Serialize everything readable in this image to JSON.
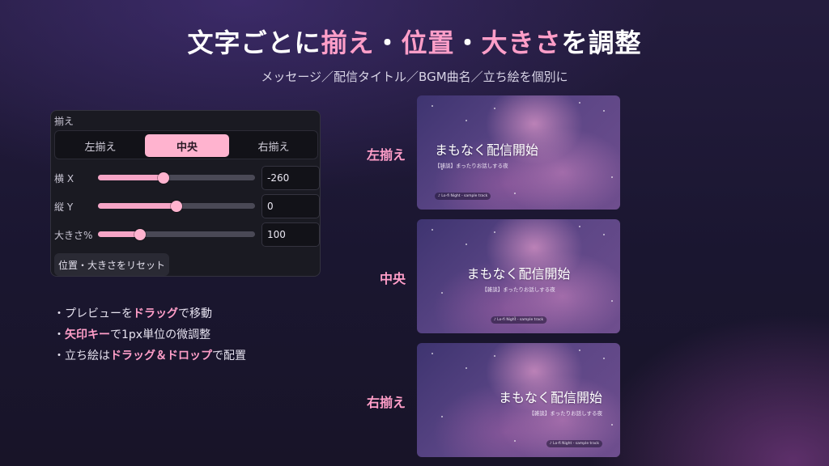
{
  "header": {
    "title_parts": [
      {
        "text": "文字ごとに",
        "hl": false
      },
      {
        "text": "揃え",
        "hl": true
      },
      {
        "text": "・",
        "hl": false
      },
      {
        "text": "位置",
        "hl": true
      },
      {
        "text": "・",
        "hl": false
      },
      {
        "text": "大きさ",
        "hl": true
      },
      {
        "text": "を調整",
        "hl": false
      }
    ],
    "subtitle": "メッセージ／配信タイトル／BGM曲名／立ち絵を個別に"
  },
  "panel": {
    "section_label": "揃え",
    "align_options": [
      {
        "label": "左揃え",
        "active": false
      },
      {
        "label": "中央",
        "active": true
      },
      {
        "label": "右揃え",
        "active": false
      }
    ],
    "rows": [
      {
        "label": "横 X",
        "value": "-260",
        "fraction": 0.42
      },
      {
        "label": "縦 Y",
        "value": "0",
        "fraction": 0.5
      },
      {
        "label": "大きさ%",
        "value": "100",
        "fraction": 0.27
      }
    ],
    "reset_label": "位置・大きさをリセット"
  },
  "tips": [
    [
      {
        "text": "・プレビューを",
        "em": false
      },
      {
        "text": "ドラッグ",
        "em": true
      },
      {
        "text": "で移動",
        "em": false
      }
    ],
    [
      {
        "text": "・",
        "em": false
      },
      {
        "text": "矢印キー",
        "em": true
      },
      {
        "text": "で1px単位の微調整",
        "em": false
      }
    ],
    [
      {
        "text": "・立ち絵は",
        "em": false
      },
      {
        "text": "ドラッグ＆ドロップ",
        "em": true
      },
      {
        "text": "で配置",
        "em": false
      }
    ]
  ],
  "previews": [
    {
      "label": "左揃え",
      "align": "left"
    },
    {
      "label": "中央",
      "align": "center"
    },
    {
      "label": "右揃え",
      "align": "right"
    }
  ],
  "preview_content": {
    "title": "まもなく配信開始",
    "subtitle": "【雑談】まったりお話しする夜",
    "music": "♪ Lo-fi Night - sample track"
  },
  "colors": {
    "accent": "#ff9ec8",
    "active_button": "#ffb3cf"
  }
}
